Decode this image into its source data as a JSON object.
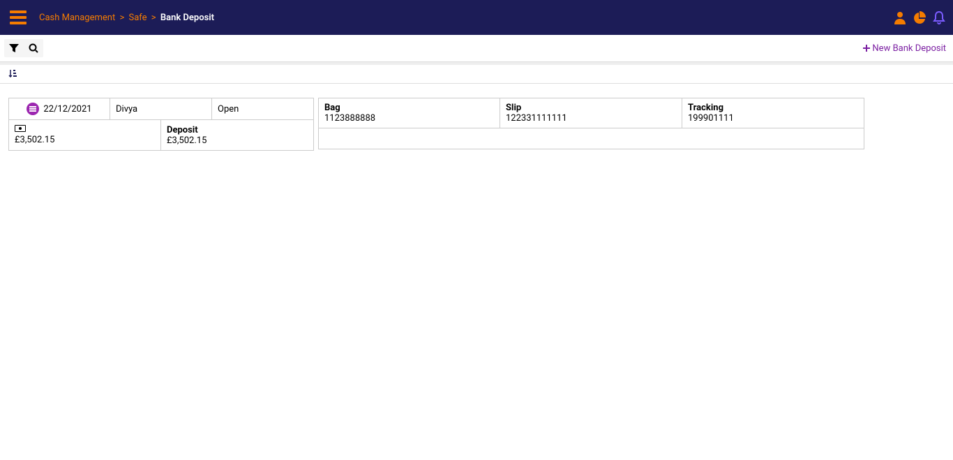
{
  "breadcrumb": {
    "item1": "Cash Management",
    "item2": "Safe",
    "current": "Bank Deposit",
    "sep": ">"
  },
  "actions": {
    "new_deposit": "New Bank Deposit"
  },
  "deposit": {
    "date": "22/12/2021",
    "user": "Divya",
    "status": "Open",
    "amount_label": "",
    "amount": "£3,502.15",
    "deposit_label": "Deposit",
    "deposit_amount": "£3,502.15",
    "bag_label": "Bag",
    "bag_value": "1123888888",
    "slip_label": "Slip",
    "slip_value": "122331111111",
    "tracking_label": "Tracking",
    "tracking_value": "199901111"
  }
}
